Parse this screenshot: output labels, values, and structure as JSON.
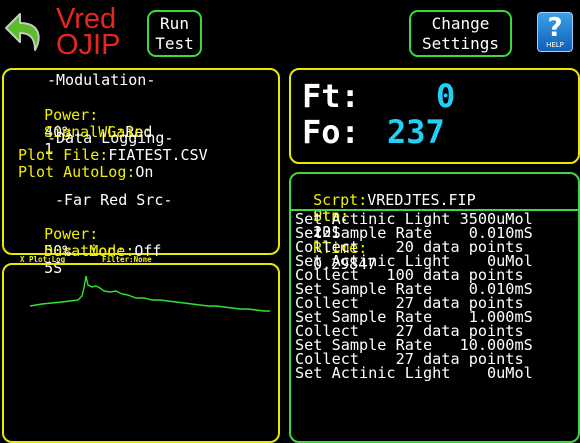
{
  "header": {
    "title_line1": "Vred",
    "title_line2": "OJIP",
    "run_button": [
      "Run",
      "Test"
    ],
    "settings_button": [
      "Change",
      "Settings"
    ],
    "help_label": "HELP",
    "back_icon": "back-arrow-icon",
    "help_icon": "question-mark-icon"
  },
  "settings": {
    "modulation_heading": "-Modulation-",
    "power_label": "Power:",
    "power_value": "40%",
    "wl_label": "WL:",
    "wl_value": "Red",
    "signal_gain_label": "Signal Gain:",
    "signal_gain_value": "1",
    "logging_heading": "-Data Logging-",
    "plot_file_label": "Plot File:",
    "plot_file_value": "FIATEST.CSV",
    "autolog_label": "Plot AutoLog:",
    "autolog_value": "On",
    "far_red_heading": "-Far Red Src-",
    "fr_power_label": "Power:",
    "fr_power_value": "50%",
    "mode_label": "Mode:",
    "mode_value": "Off",
    "duration_label": "Duration:",
    "duration_value": "5S"
  },
  "plot": {
    "x_plot_label": "X Plot:Log",
    "filter_label": "Filter:None"
  },
  "readout": {
    "ft_label": "Ft:",
    "ft_value": "0",
    "fo_label": "Fo:",
    "fo_value": "237"
  },
  "script": {
    "scrpt_label": "Scrpt:",
    "scrpt_value": "VREDJTES.FIP",
    "stp_label": "Stp:",
    "stp_value": "12",
    "pts_label": "Pts:",
    "pts_value": "201",
    "rtime_label": "RTime:",
    "rtime_value": "0.29847",
    "lines": [
      "Set Actinic Light 3500uMol",
      "Set Sample Rate    0.010mS",
      "Collect    20 data points",
      "Set Actinic Light    0uMol",
      "Collect   100 data points",
      "Set Sample Rate    0.010mS",
      "Collect    27 data points",
      "Set Sample Rate    1.000mS",
      "Collect    27 data points",
      "Set Sample Rate   10.000mS",
      "Collect    27 data points",
      "Set Actinic Light    0uMol"
    ]
  },
  "colors": {
    "panel_border": "#e8e800",
    "button_border": "#3ed83e",
    "script_border": "#3ed83e",
    "label_yellow": "#f0f000",
    "value_cyan": "#21d0f5",
    "title_red": "#e8261e",
    "trace_green": "#2ee62e"
  }
}
